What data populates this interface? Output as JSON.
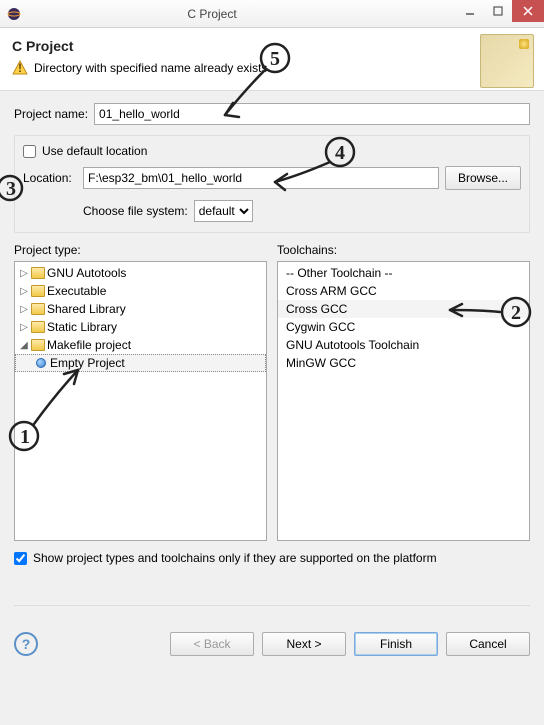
{
  "window": {
    "title": "C Project"
  },
  "header": {
    "title": "C Project",
    "warning": "Directory with specified name already exists."
  },
  "project_name": {
    "label": "Project name:",
    "value": "01_hello_world"
  },
  "location": {
    "use_default_label": "Use default location",
    "use_default_checked": false,
    "label": "Location:",
    "value": "F:\\esp32_bm\\01_hello_world",
    "browse_label": "Browse...",
    "fs_label": "Choose file system:",
    "fs_value": "default"
  },
  "project_type": {
    "label": "Project type:",
    "items": [
      {
        "label": "GNU Autotools",
        "expanded": false
      },
      {
        "label": "Executable",
        "expanded": false
      },
      {
        "label": "Shared Library",
        "expanded": false
      },
      {
        "label": "Static Library",
        "expanded": false
      },
      {
        "label": "Makefile project",
        "expanded": true,
        "children": [
          {
            "label": "Empty Project",
            "selected": true
          }
        ]
      }
    ]
  },
  "toolchains": {
    "label": "Toolchains:",
    "items": [
      {
        "label": "-- Other Toolchain --"
      },
      {
        "label": "Cross ARM GCC"
      },
      {
        "label": "Cross GCC",
        "selected": true
      },
      {
        "label": "Cygwin GCC"
      },
      {
        "label": "GNU Autotools Toolchain"
      },
      {
        "label": "MinGW GCC"
      }
    ]
  },
  "filter": {
    "label": "Show project types and toolchains only if they are supported on the platform",
    "checked": true
  },
  "buttons": {
    "back": "< Back",
    "next": "Next >",
    "finish": "Finish",
    "cancel": "Cancel"
  },
  "annotations": {
    "1": "1",
    "2": "2",
    "3": "3",
    "4": "4",
    "5": "5"
  }
}
